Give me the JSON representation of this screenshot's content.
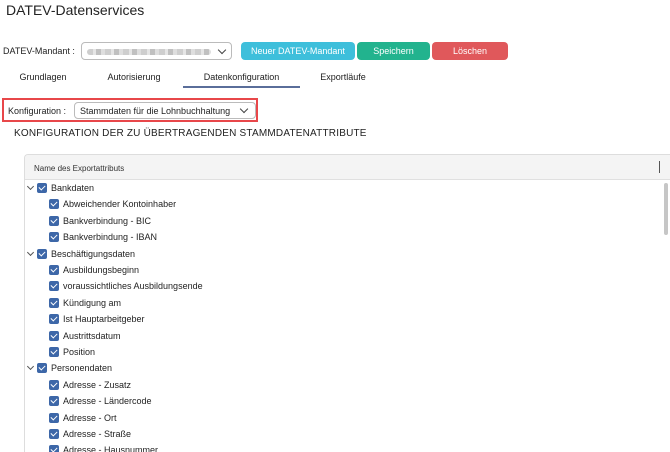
{
  "app": {
    "title": "DATEV-Datenservices"
  },
  "mandant": {
    "label": "DATEV-Mandant :",
    "buttons": {
      "new": "Neuer DATEV-Mandant",
      "save": "Speichern",
      "delete": "Löschen"
    }
  },
  "tabs": [
    {
      "label": "Grundlagen",
      "active": false
    },
    {
      "label": "Autorisierung",
      "active": false
    },
    {
      "label": "Datenkonfiguration",
      "active": true
    },
    {
      "label": "Exportläufe",
      "active": false
    }
  ],
  "konfiguration": {
    "label": "Konfiguration :",
    "value": "Stammdaten für die Lohnbuchhaltung"
  },
  "section_title": "KONFIGURATION DER ZU ÜBERTRAGENDEN STAMMDATENATTRIBUTE",
  "table": {
    "header": "Name des Exportattributs",
    "groups": [
      {
        "label": "Bankdaten",
        "checked": true,
        "expanded": true,
        "items": [
          "Abweichender Kontoinhaber",
          "Bankverbindung - BIC",
          "Bankverbindung - IBAN"
        ]
      },
      {
        "label": "Beschäftigungsdaten",
        "checked": true,
        "expanded": true,
        "items": [
          "Ausbildungsbeginn",
          "voraussichtliches Ausbildungsende",
          "Kündigung am",
          "Ist Hauptarbeitgeber",
          "Austrittsdatum",
          "Position"
        ]
      },
      {
        "label": "Personendaten",
        "checked": true,
        "expanded": true,
        "items": [
          "Adresse - Zusatz",
          "Adresse - Ländercode",
          "Adresse - Ort",
          "Adresse - Straße",
          "Adresse - Hausnummer"
        ]
      }
    ]
  },
  "colors": {
    "accent_new": "#3ebfdb",
    "accent_save": "#22b38e",
    "accent_delete": "#e0585b",
    "highlight_border": "#e8474a",
    "checkbox": "#3d67a8"
  }
}
